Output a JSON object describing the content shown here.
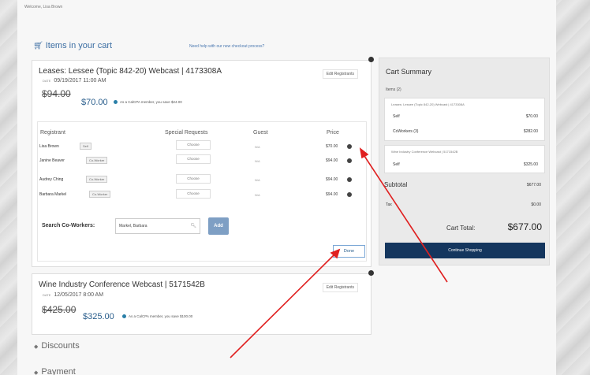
{
  "header": {
    "welcome": "Welcome, Lisa Brown"
  },
  "cart": {
    "title": "Items in your cart",
    "help_link": "Need help with our new checkout process?"
  },
  "item1": {
    "title": "Leases: Lessee (Topic 842-20) Webcast | 4173308A",
    "date_label": "DATE",
    "date": "09/19/2017 11:00 AM",
    "old_price": "$94.00",
    "new_price": "$70.00",
    "member_note": "As a CalCPA member, you save $24.00",
    "edit_label": "Edit Registrants",
    "columns": {
      "registrant": "Registrant",
      "special": "Special Requests",
      "guest": "Guest",
      "price": "Price"
    },
    "registrants": [
      {
        "name": "Lisa Brown",
        "tag": "Self",
        "choose": "Choose",
        "guest": "N/A",
        "price": "$70.00"
      },
      {
        "name": "Janine Beaver",
        "tag": "Co-Worker",
        "choose": "Choose",
        "guest": "N/A",
        "price": "$94.00"
      },
      {
        "name": "Audrey Ching",
        "tag": "Co-Worker",
        "choose": "Choose",
        "guest": "N/A",
        "price": "$94.00"
      },
      {
        "name": "Barbara Markel",
        "tag": "Co-Worker",
        "choose": "Choose",
        "guest": "N/A",
        "price": "$94.00"
      }
    ],
    "search_label": "Search Co-Workers:",
    "search_value": "Markel, Barbara",
    "add_label": "Add",
    "done_label": "Done"
  },
  "item2": {
    "title": "Wine Industry Conference Webcast | 5171542B",
    "date_label": "DATE",
    "date": "12/05/2017 8:00 AM",
    "old_price": "$425.00",
    "new_price": "$325.00",
    "member_note": "As a CalCPA member, you save $100.00",
    "edit_label": "Edit Registrants"
  },
  "summary": {
    "title": "Cart Summary",
    "items_label": "Items (2)",
    "box1_title": "Leases: Lessee (Topic 842-20) Webcast | 4173308A",
    "box1_lines": [
      {
        "label": "Self",
        "value": "$70.00"
      },
      {
        "label": "CoWorkers (3)",
        "value": "$282.00"
      }
    ],
    "box2_title": "Wine Industry Conference Webcast | 5171542B",
    "box2_lines": [
      {
        "label": "Self",
        "value": "$325.00"
      }
    ],
    "subtotal_label": "Subtotal",
    "subtotal_value": "$677.00",
    "tax_label": "Tax",
    "tax_value": "$0.00",
    "total_label": "Cart Total:",
    "total_value": "$677.00",
    "continue_label": "Continue Shopping"
  },
  "sections": {
    "discounts": "Discounts",
    "payment": "Payment"
  },
  "colors": {
    "annotation_arrow": "#e02020",
    "primary_button": "#14365e",
    "link": "#3c6ea3"
  }
}
